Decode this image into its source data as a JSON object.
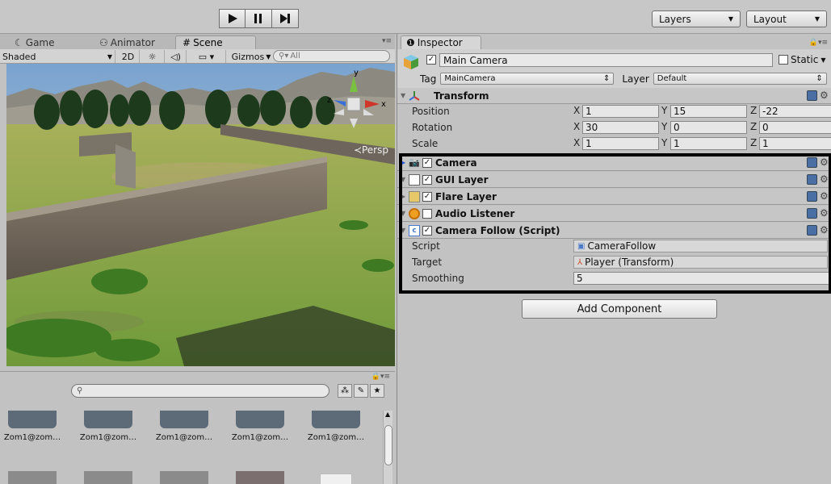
{
  "toolbar": {
    "layers_label": "Layers",
    "layout_label": "Layout"
  },
  "scene_panel": {
    "tabs": [
      {
        "label": "Game",
        "icon": "game-icon"
      },
      {
        "label": "Animator",
        "icon": "animator-icon"
      },
      {
        "label": "Scene",
        "icon": "scene-icon"
      }
    ],
    "shading": "Shaded",
    "mode_2d": "2D",
    "gizmos": "Gizmos",
    "search_placeholder": "All",
    "persp_label": "≺Persp",
    "gizmo_axes": {
      "y": "y",
      "x": "x",
      "z": "z"
    }
  },
  "project_panel": {
    "search_placeholder": "",
    "assets": [
      {
        "name": "Zom1@zom…"
      },
      {
        "name": "Zom1@zom…"
      },
      {
        "name": "Zom1@zom…"
      },
      {
        "name": "Zom1@zom…"
      },
      {
        "name": "Zom1@zom…"
      }
    ]
  },
  "inspector": {
    "tab_label": "Inspector",
    "object_name": "Main Camera",
    "static_label": "Static",
    "tag_label": "Tag",
    "tag_value": "MainCamera",
    "layer_label": "Layer",
    "layer_value": "Default",
    "transform": {
      "title": "Transform",
      "position": {
        "label": "Position",
        "x": "1",
        "y": "15",
        "z": "-22"
      },
      "rotation": {
        "label": "Rotation",
        "x": "30",
        "y": "0",
        "z": "0"
      },
      "scale": {
        "label": "Scale",
        "x": "1",
        "y": "1",
        "z": "1"
      }
    },
    "components": [
      {
        "name": "Camera"
      },
      {
        "name": "GUI Layer"
      },
      {
        "name": "Flare Layer"
      },
      {
        "name": "Audio Listener"
      },
      {
        "name": "Camera Follow (Script)"
      }
    ],
    "script_fields": {
      "script_label": "Script",
      "script_value": "CameraFollow",
      "target_label": "Target",
      "target_value": "Player (Transform)",
      "smoothing_label": "Smoothing",
      "smoothing_value": "5"
    },
    "add_component": "Add Component"
  }
}
